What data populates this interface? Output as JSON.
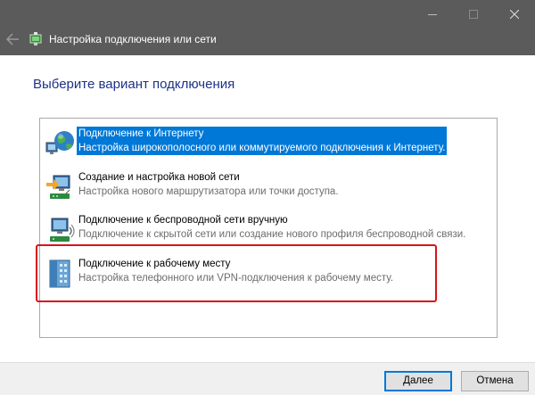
{
  "window": {
    "title": "Настройка подключения или сети"
  },
  "heading": "Выберите вариант подключения",
  "options": [
    {
      "title": "Подключение к Интернету",
      "description": "Настройка широкополосного или коммутируемого подключения к Интернету.",
      "icon": "globe-network-icon",
      "selected": true
    },
    {
      "title": "Создание и настройка новой сети",
      "description": "Настройка нового маршрутизатора или точки доступа.",
      "icon": "router-setup-icon",
      "selected": false
    },
    {
      "title": "Подключение к беспроводной сети вручную",
      "description": "Подключение к скрытой сети или создание нового профиля беспроводной связи.",
      "icon": "wireless-network-icon",
      "selected": false
    },
    {
      "title": "Подключение к рабочему месту",
      "description": "Настройка телефонного или VPN-подключения к рабочему месту.",
      "icon": "workplace-vpn-icon",
      "selected": false
    }
  ],
  "buttons": {
    "next": "Далее",
    "cancel": "Отмена"
  },
  "colors": {
    "titlebar": "#5b5b5b",
    "selection": "#0078d7",
    "heading": "#1e3287",
    "annotation_frame": "#d8131c"
  }
}
